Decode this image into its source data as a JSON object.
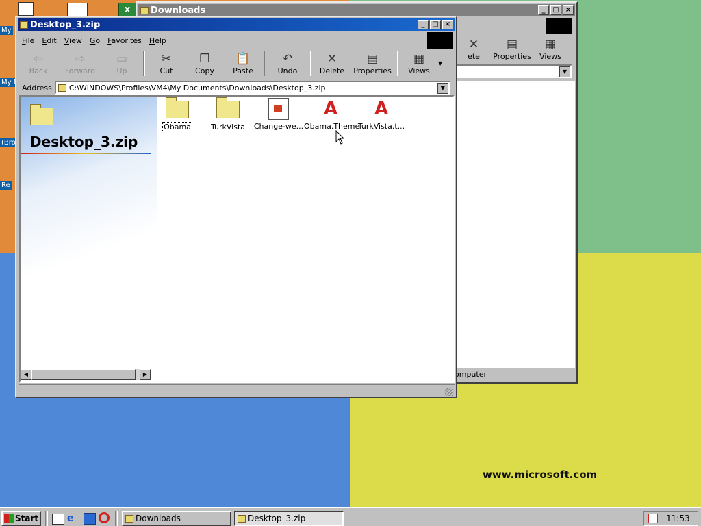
{
  "desktop": {
    "wallpaper_text": "www.microsoft.com",
    "icon_labels": [
      "My",
      "My D",
      "(Bro",
      "Re"
    ]
  },
  "back_window": {
    "title": "Downloads",
    "toolbar": [
      {
        "label": "ete",
        "icon": "delete-icon"
      },
      {
        "label": "Properties",
        "icon": "properties-icon"
      },
      {
        "label": "Views",
        "icon": "views-icon"
      }
    ],
    "status": "omputer"
  },
  "front_window": {
    "title": "Desktop_3.zip",
    "menu": [
      "File",
      "Edit",
      "View",
      "Go",
      "Favorites",
      "Help"
    ],
    "toolbar": [
      {
        "label": "Back",
        "icon": "back-arrow-icon",
        "disabled": true
      },
      {
        "label": "Forward",
        "icon": "forward-arrow-icon",
        "disabled": true
      },
      {
        "label": "Up",
        "icon": "up-folder-icon",
        "disabled": true
      },
      {
        "label": "Cut",
        "icon": "scissors-icon",
        "disabled": false
      },
      {
        "label": "Copy",
        "icon": "copy-icon",
        "disabled": false
      },
      {
        "label": "Paste",
        "icon": "paste-icon",
        "disabled": false
      },
      {
        "label": "Undo",
        "icon": "undo-icon",
        "disabled": false
      },
      {
        "label": "Delete",
        "icon": "delete-icon",
        "disabled": false
      },
      {
        "label": "Properties",
        "icon": "properties-icon",
        "disabled": false
      },
      {
        "label": "Views",
        "icon": "views-icon",
        "disabled": false
      }
    ],
    "address_label": "Address",
    "address_value": "C:\\WINDOWS\\Profiles\\VM4\\My Documents\\Downloads\\Desktop_3.zip",
    "side_title": "Desktop_3.zip",
    "files": [
      {
        "name": "Obama",
        "type": "folder",
        "selected": true
      },
      {
        "name": "TurkVista",
        "type": "folder",
        "selected": false
      },
      {
        "name": "Change-we...",
        "type": "program",
        "selected": false
      },
      {
        "name": "Obama.Theme",
        "type": "theme",
        "selected": false
      },
      {
        "name": "TurkVista.t...",
        "type": "theme",
        "selected": false
      }
    ]
  },
  "taskbar": {
    "start_label": "Start",
    "tasks": [
      {
        "label": "Downloads",
        "active": false
      },
      {
        "label": "Desktop_3.zip",
        "active": true
      }
    ],
    "clock": "11:53"
  }
}
